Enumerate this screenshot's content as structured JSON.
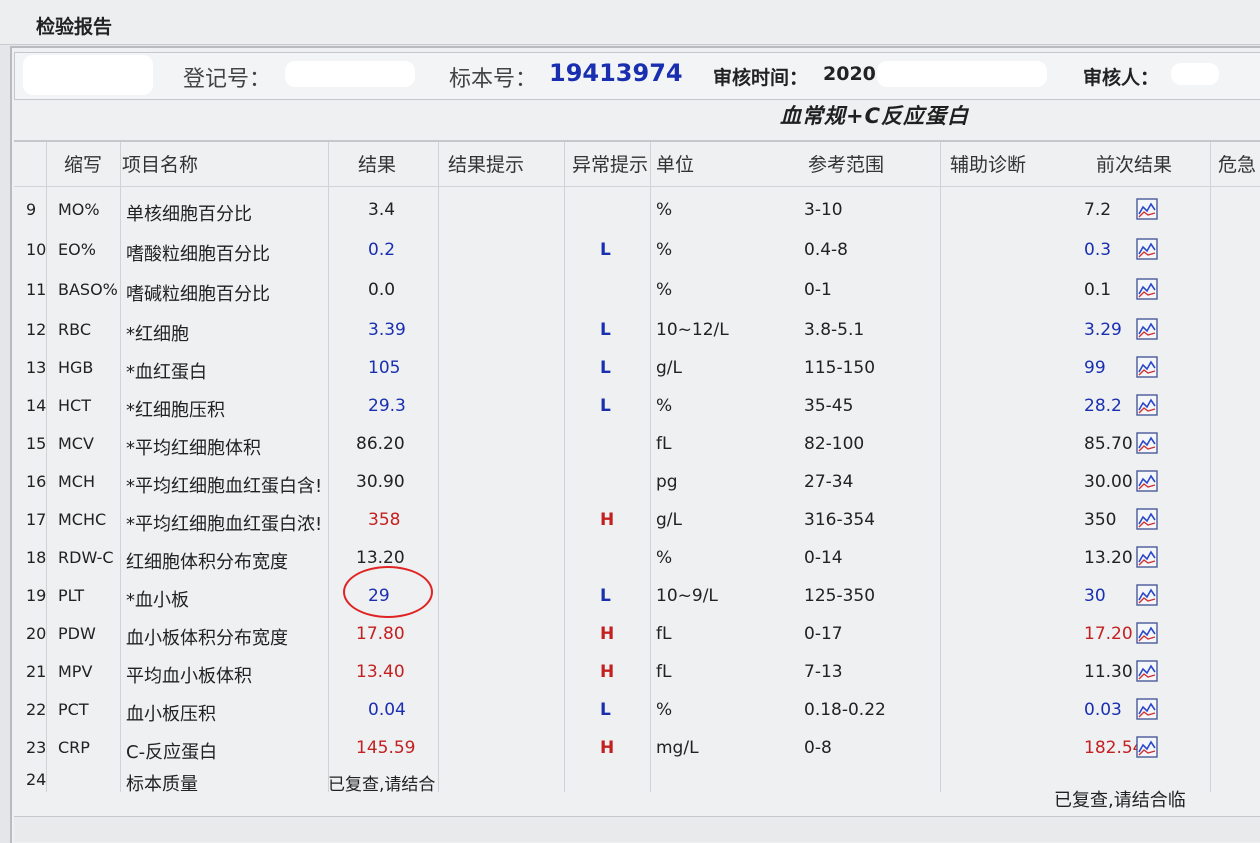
{
  "window": {
    "title": "检验报告"
  },
  "info": {
    "reg_label": "登记号：",
    "sample_label": "标本号：",
    "sample_no": "19413974",
    "review_time_label": "审核时间：",
    "review_time_value": "2020",
    "reviewer_label": "审核人："
  },
  "report_title": "血常规+C反应蛋白",
  "headers": {
    "abbr": "缩写",
    "name": "项目名称",
    "result": "结果",
    "result_hint": "结果提示",
    "abnormal": "异常提示",
    "unit": "单位",
    "ref": "参考范围",
    "aux": "辅助诊断",
    "prev": "前次结果",
    "critical": "危急"
  },
  "colors": {
    "low": "#1a2fb0",
    "high": "#c42020",
    "normal": "#222222",
    "circle": "#e02424"
  },
  "rows": [
    {
      "num": "9",
      "abbr": "MO%",
      "name": "单核细胞百分比",
      "result": "3.4",
      "rs": "n",
      "flag": "",
      "unit": "%",
      "ref": "3-10",
      "prev": "7.2",
      "ps": "n"
    },
    {
      "num": "10",
      "abbr": "EO%",
      "name": "嗜酸粒细胞百分比",
      "result": "0.2",
      "rs": "l",
      "flag": "L",
      "unit": "%",
      "ref": "0.4-8",
      "prev": "0.3",
      "ps": "l"
    },
    {
      "num": "11",
      "abbr": "BASO%",
      "name": "嗜碱粒细胞百分比",
      "result": "0.0",
      "rs": "n",
      "flag": "",
      "unit": "%",
      "ref": "0-1",
      "prev": "0.1",
      "ps": "n"
    },
    {
      "num": "12",
      "abbr": "RBC",
      "name": "*红细胞",
      "result": "3.39",
      "rs": "l",
      "flag": "L",
      "unit": "10~12/L",
      "ref": "3.8-5.1",
      "prev": "3.29",
      "ps": "l"
    },
    {
      "num": "13",
      "abbr": "HGB",
      "name": "*血红蛋白",
      "result": "105",
      "rs": "l",
      "flag": "L",
      "unit": "g/L",
      "ref": "115-150",
      "prev": "99",
      "ps": "l"
    },
    {
      "num": "14",
      "abbr": "HCT",
      "name": "*红细胞压积",
      "result": "29.3",
      "rs": "l",
      "flag": "L",
      "unit": "%",
      "ref": "35-45",
      "prev": "28.2",
      "ps": "l"
    },
    {
      "num": "15",
      "abbr": "MCV",
      "name": "*平均红细胞体积",
      "result": "86.20",
      "rs": "n",
      "flag": "",
      "unit": "fL",
      "ref": "82-100",
      "prev": "85.70",
      "ps": "n"
    },
    {
      "num": "16",
      "abbr": "MCH",
      "name": "*平均红细胞血红蛋白含!",
      "result": "30.90",
      "rs": "n",
      "flag": "",
      "unit": "pg",
      "ref": "27-34",
      "prev": "30.00",
      "ps": "n"
    },
    {
      "num": "17",
      "abbr": "MCHC",
      "name": "*平均红细胞血红蛋白浓!",
      "result": "358",
      "rs": "h",
      "flag": "H",
      "unit": "g/L",
      "ref": "316-354",
      "prev": "350",
      "ps": "n"
    },
    {
      "num": "18",
      "abbr": "RDW-C",
      "name": "红细胞体积分布宽度",
      "result": "13.20",
      "rs": "n",
      "flag": "",
      "unit": "%",
      "ref": "0-14",
      "prev": "13.20",
      "ps": "n"
    },
    {
      "num": "19",
      "abbr": "PLT",
      "name": "*血小板",
      "result": "29",
      "rs": "l",
      "flag": "L",
      "unit": "10~9/L",
      "ref": "125-350",
      "prev": "30",
      "ps": "l"
    },
    {
      "num": "20",
      "abbr": "PDW",
      "name": "血小板体积分布宽度",
      "result": "17.80",
      "rs": "h",
      "flag": "H",
      "unit": "fL",
      "ref": "0-17",
      "prev": "17.20",
      "ps": "h"
    },
    {
      "num": "21",
      "abbr": "MPV",
      "name": "平均血小板体积",
      "result": "13.40",
      "rs": "h",
      "flag": "H",
      "unit": "fL",
      "ref": "7-13",
      "prev": "11.30",
      "ps": "n"
    },
    {
      "num": "22",
      "abbr": "PCT",
      "name": "血小板压积",
      "result": "0.04",
      "rs": "l",
      "flag": "L",
      "unit": "%",
      "ref": "0.18-0.22",
      "prev": "0.03",
      "ps": "l"
    },
    {
      "num": "23",
      "abbr": "CRP",
      "name": "C-反应蛋白",
      "result": "145.59",
      "rs": "h",
      "flag": "H",
      "unit": "mg/L",
      "ref": "0-8",
      "prev": "182.54",
      "ps": "h"
    },
    {
      "num": "24",
      "abbr": "",
      "name": "标本质量",
      "result": "已复查,请结合",
      "rs": "n",
      "flag": "",
      "unit": "",
      "ref": "",
      "prev": "",
      "ps": "n"
    }
  ],
  "bottom_note": "已复查,请结合临"
}
